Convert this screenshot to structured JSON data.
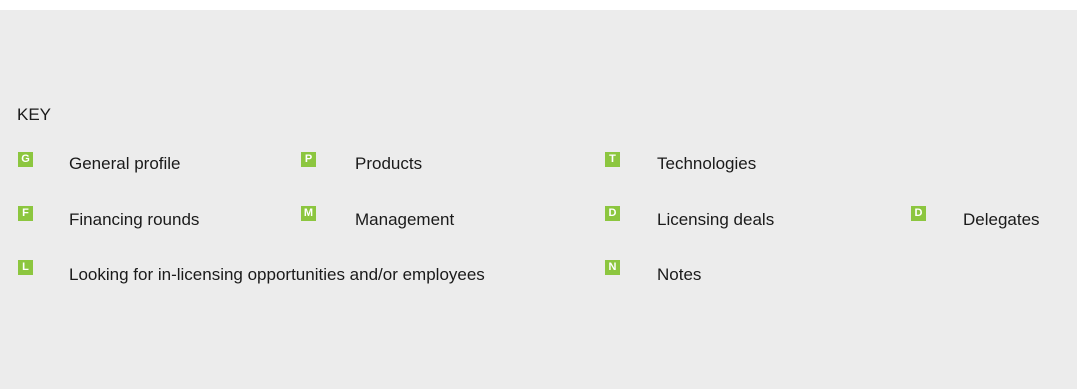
{
  "key": {
    "title": "KEY",
    "badge_color": "#8cc63f",
    "items": [
      {
        "letter": "G",
        "label": "General profile"
      },
      {
        "letter": "P",
        "label": "Products"
      },
      {
        "letter": "T",
        "label": "Technologies"
      },
      {
        "letter": "F",
        "label": "Financing rounds"
      },
      {
        "letter": "M",
        "label": "Management"
      },
      {
        "letter": "D",
        "label": "Licensing deals"
      },
      {
        "letter": "D",
        "label": "Delegates"
      },
      {
        "letter": "L",
        "label": "Looking for in-licensing opportunities and/or employees"
      },
      {
        "letter": "N",
        "label": "Notes"
      }
    ]
  }
}
